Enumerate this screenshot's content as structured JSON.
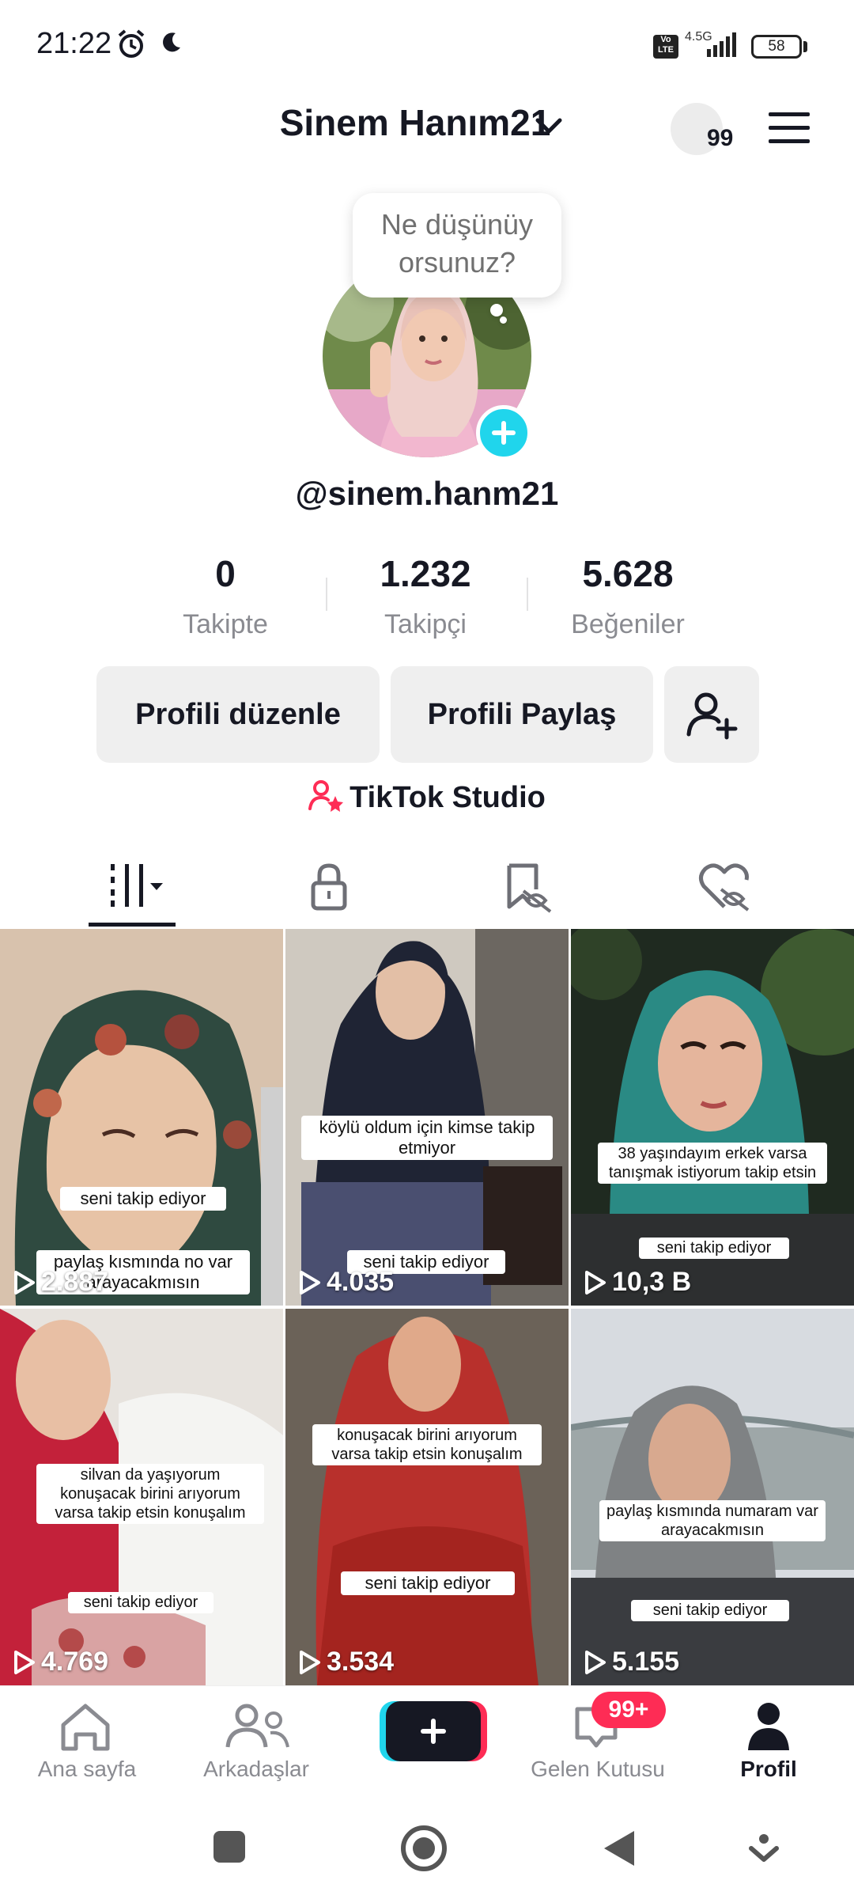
{
  "status_bar": {
    "time": "21:22",
    "volte": "Vo LTE",
    "network": "4.5G",
    "battery": "58"
  },
  "header": {
    "profile_name": "Sinem Hanım21",
    "notification_count": "99"
  },
  "profile": {
    "thought_bubble_line1": "Ne düşünüy",
    "thought_bubble_line2": "orsunuz?",
    "username": "@sinem.hanm21"
  },
  "stats": [
    {
      "value": "0",
      "label": "Takipte"
    },
    {
      "value": "1.232",
      "label": "Takipçi"
    },
    {
      "value": "5.628",
      "label": "Beğeniler"
    }
  ],
  "actions": {
    "edit_profile": "Profili düzenle",
    "share_profile": "Profili Paylaş",
    "studio": "TikTok Studio"
  },
  "tabs": [
    {
      "icon": "videos-grid-icon",
      "active": true
    },
    {
      "icon": "lock-icon",
      "active": false
    },
    {
      "icon": "reposts-hidden-icon",
      "active": false
    },
    {
      "icon": "liked-hidden-icon",
      "active": false
    }
  ],
  "videos": [
    {
      "caption1": "seni takip ediyor",
      "caption2": "paylaş kısmında no var arayacakmısın",
      "views": "2.887"
    },
    {
      "caption1": "köylü oldum için kimse takip etmiyor",
      "caption2": "seni takip ediyor",
      "views": "4.035"
    },
    {
      "caption1": "38 yaşındayım erkek varsa tanışmak istiyorum takip etsin",
      "caption2": "seni takip ediyor",
      "views": "10,3 B"
    },
    {
      "caption1": "silvan da yaşıyorum konuşacak birini arıyorum varsa takip etsin konuşalım",
      "caption2": "seni takip ediyor",
      "views": "4.769"
    },
    {
      "caption1": "konuşacak birini arıyorum varsa takip etsin konuşalım",
      "caption2": "seni takip ediyor",
      "views": "3.534"
    },
    {
      "caption1": "paylaş kısmında numaram var arayacakmısın",
      "caption2": "seni takip ediyor",
      "views": "5.155"
    }
  ],
  "nav": {
    "home": "Ana sayfa",
    "friends": "Arkadaşlar",
    "inbox": "Gelen Kutusu",
    "inbox_badge": "99+",
    "profile": "Profil"
  },
  "colors": {
    "accent_cyan": "#20d5ec",
    "accent_red": "#fe2c55",
    "text": "#161823",
    "muted": "#8a8b91"
  }
}
